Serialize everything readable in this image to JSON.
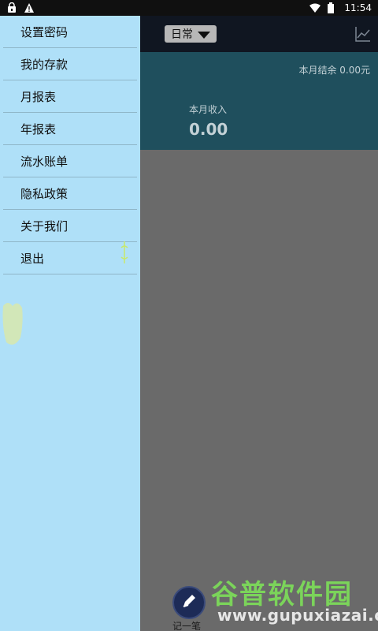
{
  "status_bar": {
    "time": "11:54",
    "icons": [
      "lock-icon",
      "warning-icon",
      "wifi-icon",
      "battery-icon"
    ]
  },
  "app_bar": {
    "book_selector": "日常",
    "trend_icon": "trend-chart-icon"
  },
  "summary": {
    "monthly_balance": "本月结余 0.00元",
    "monthly_income_label": "本月收入",
    "monthly_income_value": "0.00"
  },
  "fab": {
    "label": "记一笔",
    "icon": "pencil-icon"
  },
  "drawer": {
    "items": [
      {
        "label": "设置密码"
      },
      {
        "label": "我的存款"
      },
      {
        "label": "月报表"
      },
      {
        "label": "年报表"
      },
      {
        "label": "流水账单"
      },
      {
        "label": "隐私政策"
      },
      {
        "label": "关于我们"
      },
      {
        "label": "退出"
      }
    ]
  },
  "watermark": {
    "text_cn": "谷普软件园",
    "url": "www.gupuxiazai.com"
  },
  "colors": {
    "drawer_bg": "#afe0f8",
    "overlay": "#6a6a6a",
    "header": "#101621",
    "summary_bg": "#1f4f5d",
    "watermark_green": "#7bd45a"
  }
}
